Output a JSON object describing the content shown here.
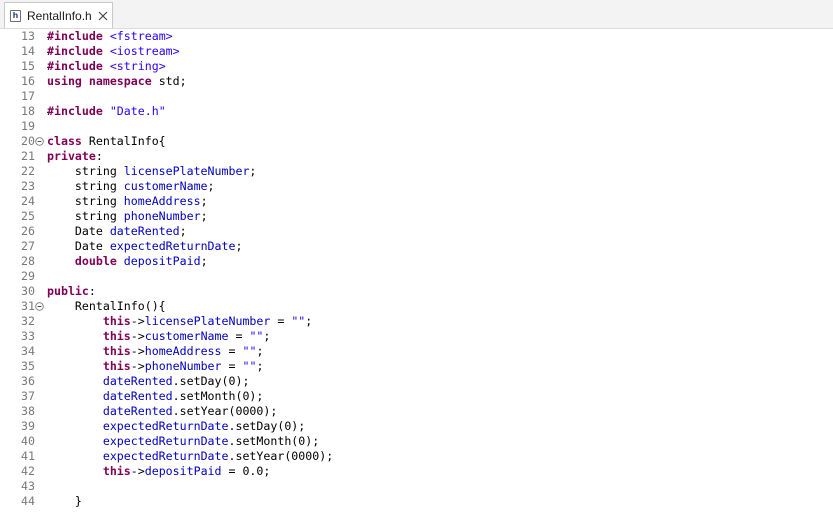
{
  "tab": {
    "title": "RentalInfo.h",
    "file_icon_glyph": "h",
    "icons": [
      "header-file-icon",
      "close-icon",
      "fold-toggle-icon"
    ]
  },
  "colors": {
    "keyword": "#7f0055",
    "string": "#2a00ff",
    "field": "#0000c0",
    "line_number": "#787878"
  },
  "editor": {
    "lines": [
      {
        "num": "13",
        "code": "#include <fstream>"
      },
      {
        "num": "14",
        "code": "#include <iostream>"
      },
      {
        "num": "15",
        "code": "#include <string>"
      },
      {
        "num": "16",
        "code": "using namespace std;"
      },
      {
        "num": "17",
        "code": ""
      },
      {
        "num": "18",
        "code": "#include \"Date.h\""
      },
      {
        "num": "19",
        "code": ""
      },
      {
        "num": "20",
        "code": "class RentalInfo{",
        "fold": true
      },
      {
        "num": "21",
        "code": "private:"
      },
      {
        "num": "22",
        "code": "    string licensePlateNumber;"
      },
      {
        "num": "23",
        "code": "    string customerName;"
      },
      {
        "num": "24",
        "code": "    string homeAddress;"
      },
      {
        "num": "25",
        "code": "    string phoneNumber;"
      },
      {
        "num": "26",
        "code": "    Date dateRented;"
      },
      {
        "num": "27",
        "code": "    Date expectedReturnDate;"
      },
      {
        "num": "28",
        "code": "    double depositPaid;"
      },
      {
        "num": "29",
        "code": ""
      },
      {
        "num": "30",
        "code": "public:"
      },
      {
        "num": "31",
        "code": "    RentalInfo(){",
        "fold": true
      },
      {
        "num": "32",
        "code": "        this->licensePlateNumber = \"\";"
      },
      {
        "num": "33",
        "code": "        this->customerName = \"\";"
      },
      {
        "num": "34",
        "code": "        this->homeAddress = \"\";"
      },
      {
        "num": "35",
        "code": "        this->phoneNumber = \"\";"
      },
      {
        "num": "36",
        "code": "        dateRented.setDay(0);"
      },
      {
        "num": "37",
        "code": "        dateRented.setMonth(0);"
      },
      {
        "num": "38",
        "code": "        dateRented.setYear(0000);"
      },
      {
        "num": "39",
        "code": "        expectedReturnDate.setDay(0);"
      },
      {
        "num": "40",
        "code": "        expectedReturnDate.setMonth(0);"
      },
      {
        "num": "41",
        "code": "        expectedReturnDate.setYear(0000);"
      },
      {
        "num": "42",
        "code": "        this->depositPaid = 0.0;"
      },
      {
        "num": "43",
        "code": ""
      },
      {
        "num": "44",
        "code": "    }"
      }
    ]
  }
}
